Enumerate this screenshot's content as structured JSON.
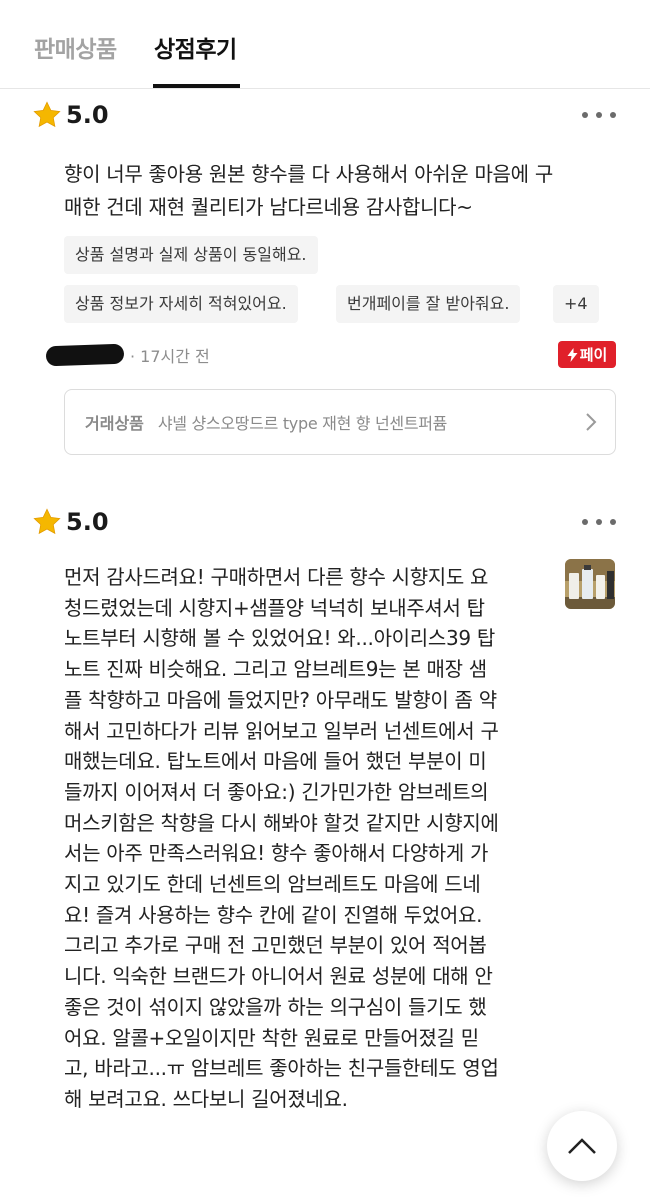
{
  "tabs": [
    {
      "label": "판매상품",
      "active": false
    },
    {
      "label": "상점후기",
      "active": true
    }
  ],
  "reviews": [
    {
      "rating": "5.0",
      "text": "향이 너무 좋아용 원본 향수를 다 사용해서 아쉬운 마음에 구\n매한 건데 재현 퀄리티가 남다르네용 감사합니다~",
      "tags": [
        "상품 설명과 실제 상품이 동일해요.",
        "상품 정보가 자세히 적혀있어요.",
        "번개페이를 잘 받아줘요.",
        "+4"
      ],
      "time": "· 17시간 전",
      "payment_badge": "페이",
      "product_label": "거래상품",
      "product_name": "샤넬 샹스오땅드르 type 재현 향 넌센트퍼퓸"
    },
    {
      "rating": "5.0",
      "text": "먼저 감사드려요! 구매하면서 다른 향수 시향지도 요\n청드렸었는데 시향지+샘플양 넉넉히 보내주셔서 탑\n노트부터 시향해 볼 수 있었어요! 와...아이리스39 탑\n노트 진짜 비슷해요. 그리고 암브레트9는 본 매장 샘\n플 착향하고 마음에 들었지만? 아무래도 발향이 좀 약\n해서 고민하다가 리뷰 읽어보고 일부러 넌센트에서 구\n매했는데요. 탑노트에서 마음에 들어 했던 부분이 미\n들까지 이어져서 더 좋아요:) 긴가민가한 암브레트의\n머스키함은 착향을 다시 해봐야 할것 같지만 시향지에\n서는 아주 만족스러워요! 향수 좋아해서 다양하게 가\n지고 있기도 한데 넌센트의 암브레트도 마음에 드네\n요! 즐겨 사용하는 향수 칸에  같이 진열해 두었어요.\n그리고 추가로 구매 전 고민했던 부분이 있어 적어봅\n니다. 익숙한 브랜드가 아니어서 원료 성분에 대해 안\n좋은 것이 섞이지 않았을까 하는 의구심이 들기도 했\n어요. 알콜+오일이지만 착한 원료로 만들어졌길 믿\n고, 바라고...ㅠ 암브레트 좋아하는 친구들한테도 영업\n해 보려고요. 쓰다보니 길어졌네요."
    }
  ],
  "icons": {
    "star": "star-icon",
    "more": "more-icon",
    "pay": "lightning-icon",
    "chevron": "chevron-right-icon",
    "scroll_top": "chevron-up-icon"
  },
  "colors": {
    "star": "#F5B700",
    "pay_badge": "#E0202A",
    "active_tab": "#111111",
    "inactive_tab": "#A3A3A3"
  }
}
